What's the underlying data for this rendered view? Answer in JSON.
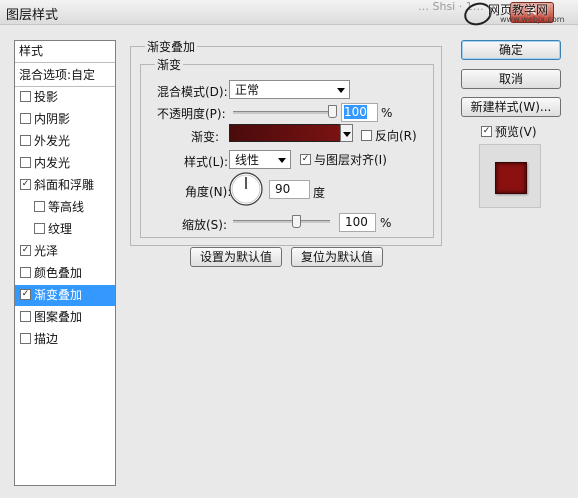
{
  "window": {
    "title": "图层样式",
    "close_glyph": "✕",
    "watermark_text": "…  Shsi · 1… ",
    "brand": "网页教学网",
    "brand_url": "www.webjx.com"
  },
  "styles_panel": {
    "header": "样式",
    "blend_options": "混合选项:自定",
    "items": [
      {
        "label": "投影",
        "checked": false
      },
      {
        "label": "内阴影",
        "checked": false
      },
      {
        "label": "外发光",
        "checked": false
      },
      {
        "label": "内发光",
        "checked": false
      },
      {
        "label": "斜面和浮雕",
        "checked": true
      },
      {
        "label": "等高线",
        "checked": false
      },
      {
        "label": "纹理",
        "checked": false
      },
      {
        "label": "光泽",
        "checked": true
      },
      {
        "label": "颜色叠加",
        "checked": false
      },
      {
        "label": "渐变叠加",
        "checked": true,
        "selected": true
      },
      {
        "label": "图案叠加",
        "checked": false
      },
      {
        "label": "描边",
        "checked": false
      }
    ]
  },
  "gradient_overlay": {
    "group_title": "渐变叠加",
    "sub_group_title": "渐变",
    "blend_mode_label": "混合模式(D):",
    "blend_mode_value": "正常",
    "opacity_label": "不透明度(P):",
    "opacity_value": "100",
    "opacity_level": 1.0,
    "percent": "%",
    "gradient_label": "渐变:",
    "gradient_color_start": "#4a0b0b",
    "gradient_color_end": "#7a1212",
    "reverse_label": "反向(R)",
    "reverse_checked": false,
    "style_label": "样式(L):",
    "style_value": "线性",
    "align_label": "与图层对齐(I)",
    "align_checked": true,
    "angle_label": "角度(N):",
    "angle_value": "90",
    "angle_unit": "度",
    "scale_label": "缩放(S):",
    "scale_value": "100",
    "scale_level": 0.5,
    "make_default_button": "设置为默认值",
    "reset_default_button": "复位为默认值"
  },
  "right_panel": {
    "ok_button": "确定",
    "cancel_button": "取消",
    "new_style_button": "新建样式(W)...",
    "preview_label": "预览(V)",
    "preview_checked": true,
    "preview_swatch_color": "#8b1111"
  }
}
